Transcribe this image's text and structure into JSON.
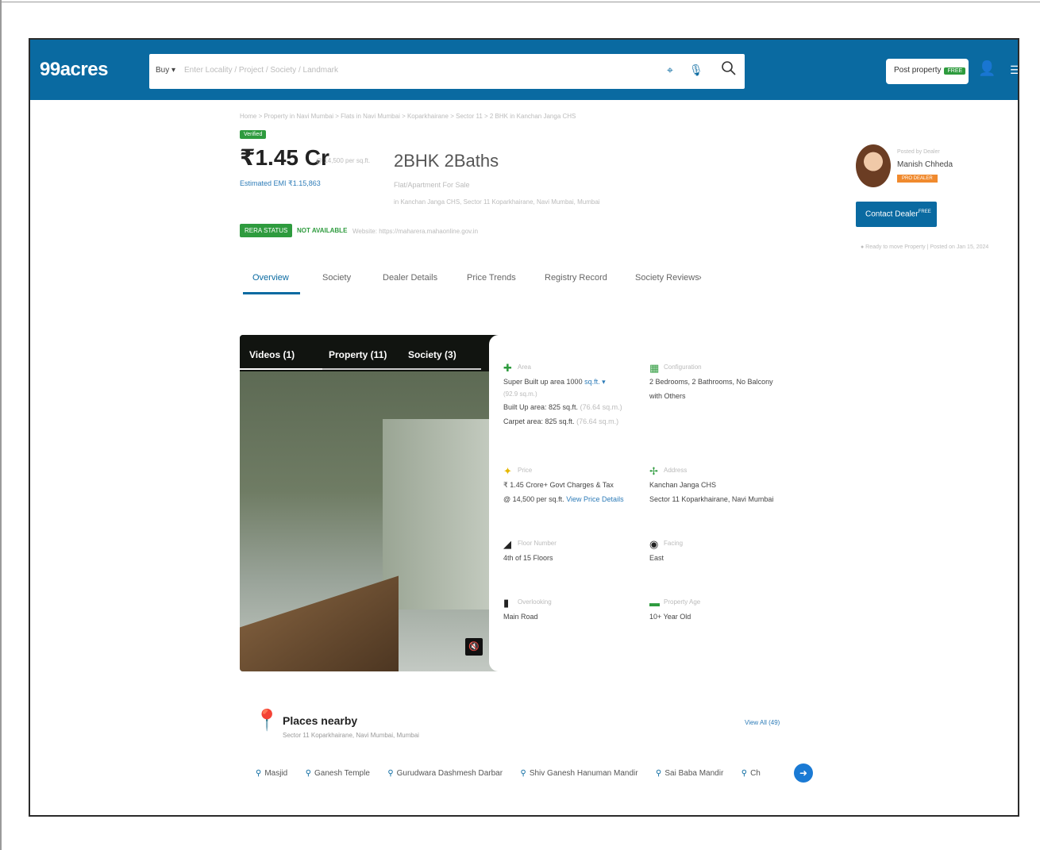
{
  "header": {
    "logo": "99acres",
    "buy_label": "Buy ▾",
    "search_placeholder": "Enter Locality / Project / Society / Landmark",
    "post_property_label": "Post property",
    "post_property_badge": "FREE"
  },
  "breadcrumb": "Home > Property in Navi Mumbai > Flats in Navi Mumbai > Koparkhairane > Sector 11 > 2 BHK in Kanchan Janga CHS",
  "listing": {
    "verified_label": "Verified",
    "price": "₹1.45 Cr",
    "price_per_sqft": "@ 14,500 per sq.ft.",
    "emi": "Estimated EMI ₹1.15,863",
    "config": "2BHK 2Baths",
    "config_sub1": "Flat/Apartment For Sale",
    "config_sub2": "in Kanchan Janga CHS, Sector 11 Koparkhairane, Navi Mumbai, Mumbai",
    "rera_status": "RERA STATUS",
    "rera_value": "NOT AVAILABLE",
    "rera_website": "Website: https://maharera.mahaonline.gov.in"
  },
  "tabs": [
    {
      "label": "Overview"
    },
    {
      "label": "Society"
    },
    {
      "label": "Dealer Details"
    },
    {
      "label": "Price Trends"
    },
    {
      "label": "Registry Record"
    },
    {
      "label": "Society Reviews"
    }
  ],
  "tabs_next": "›",
  "dealer": {
    "label": "Posted by Dealer",
    "name": "Manish Chheda",
    "tag": "PRO DEALER",
    "contact_label": "Contact Dealer",
    "contact_badge": "FREE",
    "ready": "● Ready to move Property  |  Posted on Jan 15, 2024"
  },
  "media": {
    "tabs": [
      "Videos (1)",
      "Property (11)",
      "Society (3)"
    ]
  },
  "details": {
    "area": {
      "label": "Area",
      "line1": "Super Built up area 1000",
      "line1_link": "sq.ft. ▾",
      "line1b": "(92.9 sq.m.)",
      "line2": "Built Up area: 825 sq.ft.",
      "line2_muted": "(76.64 sq.m.)",
      "line3": "Carpet area: 825 sq.ft.",
      "line3_muted": "(76.64 sq.m.)"
    },
    "configuration": {
      "label": "Configuration",
      "line1": "2 Bedrooms, 2 Bathrooms, No Balcony",
      "line2": "with Others"
    },
    "price": {
      "label": "Price",
      "line1": "₹ 1.45 Crore+ Govt Charges & Tax",
      "line2": "@ 14,500 per sq.ft.",
      "line2_link": "View Price Details"
    },
    "address": {
      "label": "Address",
      "line1": "Kanchan Janga CHS",
      "line2": "Sector 11 Koparkhairane, Navi Mumbai"
    },
    "floor": {
      "label": "Floor Number",
      "line1": "4th of 15 Floors"
    },
    "facing": {
      "label": "Facing",
      "line1": "East"
    },
    "overlooking": {
      "label": "Overlooking",
      "line1": "Main Road"
    },
    "age": {
      "label": "Property Age",
      "line1": "10+ Year Old"
    }
  },
  "places": {
    "title": "Places nearby",
    "subtitle": "Sector 11 Koparkhairane, Navi Mumbai, Mumbai",
    "view_all": "View All (49)",
    "items": [
      "Masjid",
      "Ganesh Temple",
      "Gurudwara Dashmesh Darbar",
      "Shiv Ganesh Hanuman Mandir",
      "Sai Baba Mandir",
      "Ch"
    ]
  },
  "colors": {
    "brand": "#0a6aa1",
    "verified": "#2e9b3e",
    "link": "#2e7cb8"
  }
}
